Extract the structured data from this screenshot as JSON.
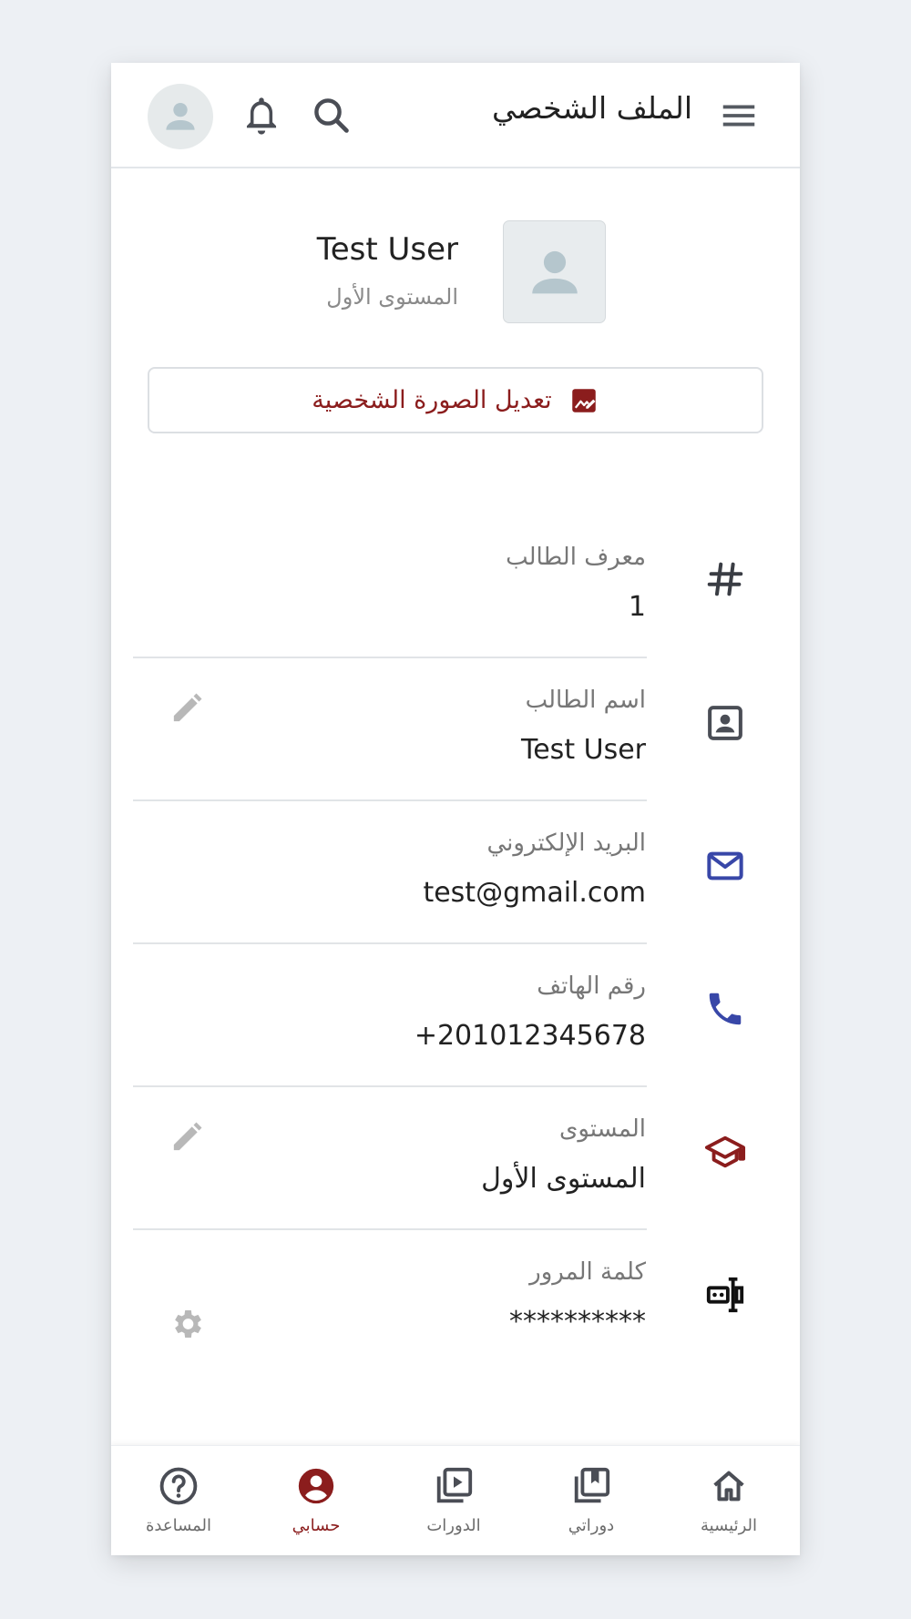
{
  "header": {
    "title": "الملف الشخصي"
  },
  "profile": {
    "name": "Test User",
    "level": "المستوى الأول",
    "edit_photo_label": "تعديل الصورة الشخصية"
  },
  "fields": [
    {
      "label": "معرف الطالب",
      "value": "1",
      "icon": "hash-icon",
      "action": null
    },
    {
      "label": "اسم الطالب",
      "value": "Test User",
      "icon": "contact-card-icon",
      "action": "edit-icon"
    },
    {
      "label": "البريد الإلكتروني",
      "value": "test@gmail.com",
      "icon": "mail-icon",
      "action": null
    },
    {
      "label": "رقم الهاتف",
      "value": "+201012345678",
      "icon": "phone-icon",
      "action": null
    },
    {
      "label": "المستوى",
      "value": "المستوى الأول",
      "icon": "graduation-cap-icon",
      "action": "edit-icon"
    },
    {
      "label": "كلمة المرور",
      "value": "**********",
      "icon": "password-icon",
      "action": "gear-icon"
    }
  ],
  "bottom_nav": [
    {
      "label": "الرئيسية",
      "icon": "home-icon",
      "active": false
    },
    {
      "label": "دوراتي",
      "icon": "my-courses-icon",
      "active": false
    },
    {
      "label": "الدورات",
      "icon": "courses-play-icon",
      "active": false
    },
    {
      "label": "حسابي",
      "icon": "account-circle-icon",
      "active": true
    },
    {
      "label": "المساعدة",
      "icon": "help-icon",
      "active": false
    }
  ],
  "colors": {
    "background": "#edf0f4",
    "accent": "#8b1d1d",
    "blue_icon": "#3847a8",
    "dark_icon": "#4a4d55",
    "action_icon": "#b8b8b8"
  }
}
